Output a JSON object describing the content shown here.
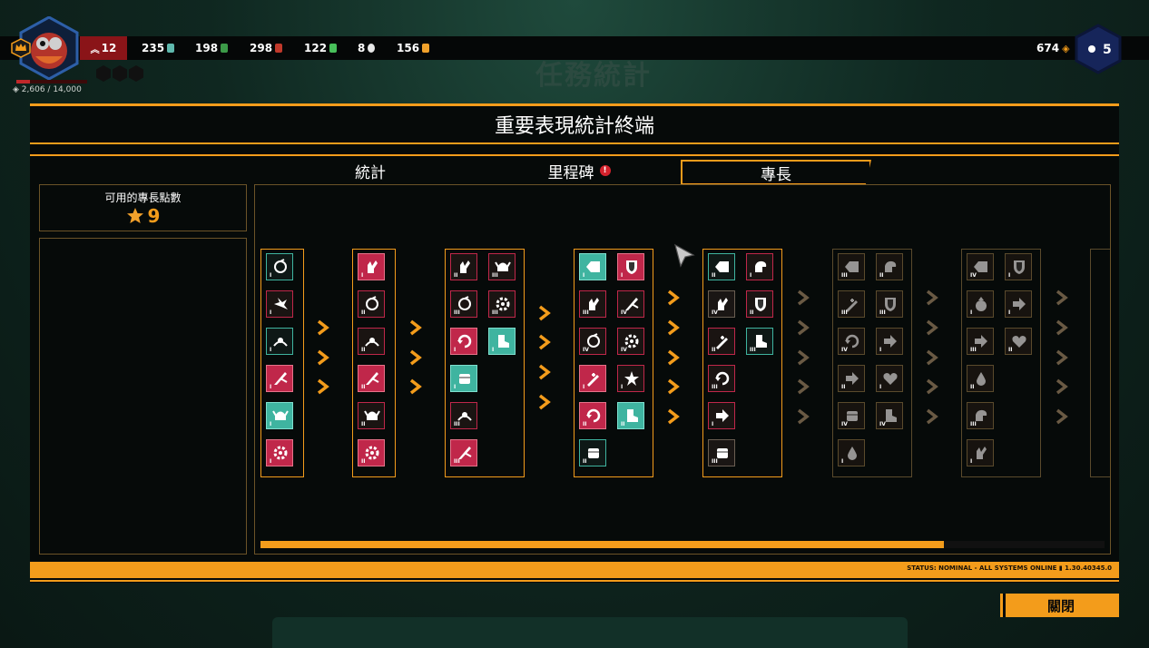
{
  "hud": {
    "xp": "2,606 / 14,000",
    "xp_fraction": 0.186,
    "resources": [
      {
        "name": "red-rank",
        "value": "12",
        "color": "#ffffff"
      },
      {
        "name": "teal-crystal",
        "value": "235",
        "color": "#5fb8ad"
      },
      {
        "name": "green-leaf",
        "value": "198",
        "color": "#3c9a48"
      },
      {
        "name": "red-flame",
        "value": "298",
        "color": "#c0392b"
      },
      {
        "name": "green-gem",
        "value": "122",
        "color": "#48c05a"
      },
      {
        "name": "white-orb",
        "value": "8",
        "color": "#e8e8e8"
      },
      {
        "name": "gold-chunk",
        "value": "156",
        "color": "#f0a12b"
      }
    ],
    "coins": "674",
    "level": "5"
  },
  "background_title": "任務統計",
  "panel": {
    "title": "重要表現統計終端",
    "tabs": {
      "stats": "統計",
      "milestones": "里程碑",
      "specialty": "專長"
    },
    "milestone_alert": "!",
    "points_label": "可用的專長點數",
    "points_value": "9",
    "status": "STATUS: NOMINAL - ALL SYSTEMS ONLINE ▮ 1.30.40345.0",
    "progress": 0.81
  },
  "close_label": "關閉",
  "colors": {
    "accent": "#f39c1b",
    "red": "#c0274a",
    "teal": "#3fb4a0"
  },
  "tree": {
    "columns": [
      {
        "skills": [
          {
            "r": "I",
            "k": "tealo",
            "g": "swirl"
          },
          {
            "r": "I",
            "k": "dark",
            "g": "burst"
          },
          {
            "r": "I",
            "k": "tealo",
            "g": "wave"
          },
          {
            "r": "I",
            "k": "red",
            "g": "slash"
          },
          {
            "r": "I",
            "k": "teal",
            "g": "helm"
          },
          {
            "r": "I",
            "k": "red",
            "g": "gear"
          }
        ]
      },
      {
        "skills": [
          {
            "r": "I",
            "k": "red",
            "g": "hand"
          },
          {
            "r": "II",
            "k": "dark",
            "g": "swirl"
          },
          {
            "r": "II",
            "k": "dark",
            "g": "wave"
          },
          {
            "r": "II",
            "k": "red",
            "g": "slash"
          },
          {
            "r": "II",
            "k": "dark",
            "g": "helm"
          },
          {
            "r": "II",
            "k": "red",
            "g": "gear"
          }
        ]
      },
      {
        "skills": [
          {
            "r": "II",
            "k": "dark",
            "g": "hand"
          },
          {
            "r": "III",
            "k": "dark",
            "g": "helm"
          },
          {
            "r": "III",
            "k": "dark",
            "g": "swirl"
          },
          {
            "r": "III",
            "k": "dark",
            "g": "gear"
          },
          {
            "r": "I",
            "k": "red",
            "g": "cycle"
          },
          {
            "r": "I",
            "k": "teal",
            "g": "boot"
          },
          {
            "r": "I",
            "k": "teal",
            "g": "fist"
          },
          {
            "r": "III",
            "k": "dark",
            "g": "wave"
          },
          {
            "r": "III",
            "k": "red",
            "g": "slash"
          }
        ]
      },
      {
        "skills": [
          {
            "r": "I",
            "k": "teal",
            "g": "sign"
          },
          {
            "r": "I",
            "k": "red",
            "g": "shield"
          },
          {
            "r": "III",
            "k": "dark",
            "g": "hand"
          },
          {
            "r": "IV",
            "k": "dark",
            "g": "slash"
          },
          {
            "r": "IV",
            "k": "dark",
            "g": "swirl"
          },
          {
            "r": "IV",
            "k": "dark",
            "g": "gear"
          },
          {
            "r": "I",
            "k": "red",
            "g": "sword"
          },
          {
            "r": "I",
            "k": "dark",
            "g": "star"
          },
          {
            "r": "II",
            "k": "red",
            "g": "cycle"
          },
          {
            "r": "II",
            "k": "teal",
            "g": "boot"
          },
          {
            "r": "II",
            "k": "tealo",
            "g": "fist"
          }
        ]
      },
      {
        "skills": [
          {
            "r": "II",
            "k": "tealo",
            "g": "sign"
          },
          {
            "r": "I",
            "k": "dark",
            "g": "arm"
          },
          {
            "r": "IV",
            "k": "gray",
            "g": "hand"
          },
          {
            "r": "II",
            "k": "dark",
            "g": "shield"
          },
          {
            "r": "II",
            "k": "dark",
            "g": "sword"
          },
          {
            "r": "III",
            "k": "tealo",
            "g": "boot"
          },
          {
            "r": "III",
            "k": "dark",
            "g": "cycle"
          },
          {
            "r": "I",
            "k": "dark",
            "g": "arrow"
          },
          {
            "r": "III",
            "k": "gray",
            "g": "fist"
          }
        ]
      },
      {
        "skills": [
          {
            "r": "III",
            "k": "dim",
            "g": "sign"
          },
          {
            "r": "II",
            "k": "dim",
            "g": "arm"
          },
          {
            "r": "III",
            "k": "dim",
            "g": "sword"
          },
          {
            "r": "III",
            "k": "dim",
            "g": "shield"
          },
          {
            "r": "IV",
            "k": "dim",
            "g": "cycle"
          },
          {
            "r": "I",
            "k": "dim",
            "g": "arrow"
          },
          {
            "r": "II",
            "k": "dim",
            "g": "arrow"
          },
          {
            "r": "I",
            "k": "dim",
            "g": "heart"
          },
          {
            "r": "IV",
            "k": "dim",
            "g": "fist"
          },
          {
            "r": "IV",
            "k": "dim",
            "g": "boot"
          },
          {
            "r": "I",
            "k": "dim",
            "g": "drop"
          }
        ]
      },
      {
        "skills": [
          {
            "r": "IV",
            "k": "dim",
            "g": "sign"
          },
          {
            "r": "I",
            "k": "dim",
            "g": "shield"
          },
          {
            "r": "I",
            "k": "dim",
            "g": "bag"
          },
          {
            "r": "I",
            "k": "dim",
            "g": "arrow"
          },
          {
            "r": "III",
            "k": "dim",
            "g": "arrow"
          },
          {
            "r": "II",
            "k": "dim",
            "g": "heart"
          },
          {
            "r": "II",
            "k": "dim",
            "g": "drop"
          },
          {
            "r": "III",
            "k": "dim",
            "g": "arm"
          },
          {
            "r": "I",
            "k": "dim",
            "g": "hand"
          }
        ]
      }
    ]
  }
}
